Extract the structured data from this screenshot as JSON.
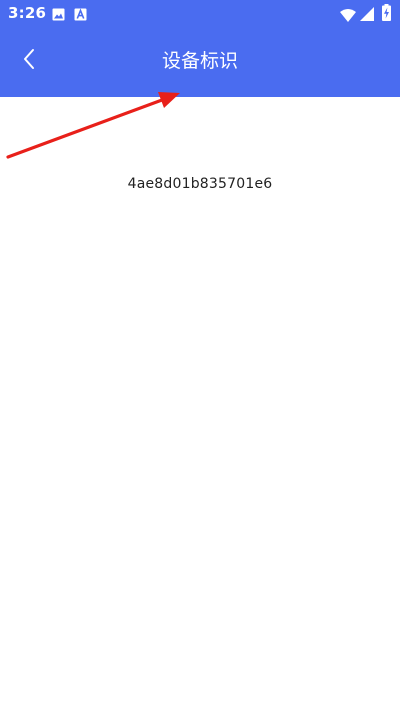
{
  "status_bar": {
    "time": "3:26",
    "icons": [
      "image-icon",
      "a-letter-icon",
      "wifi-icon",
      "signal-icon",
      "battery-charging-icon"
    ]
  },
  "app_bar": {
    "title": "设备标识",
    "back_icon": "chevron-left-icon"
  },
  "content": {
    "device_id": "4ae8d01b835701e6"
  },
  "colors": {
    "primary": "#4a6cf0",
    "on_primary": "#ffffff",
    "text": "#222222",
    "annotation_arrow": "#e8201a"
  }
}
